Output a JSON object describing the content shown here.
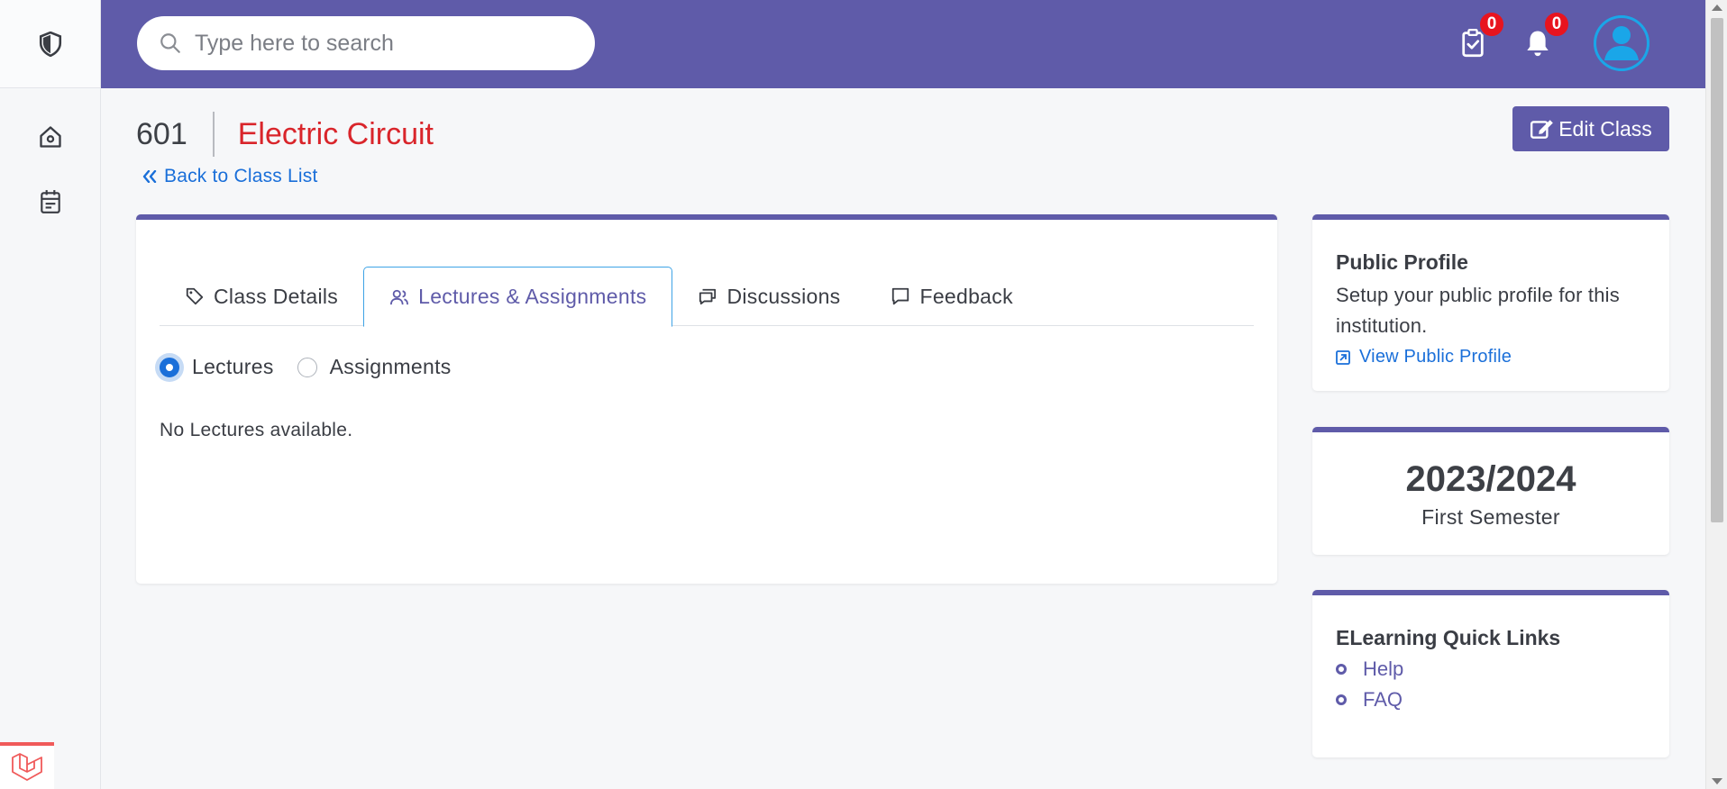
{
  "header": {
    "search_placeholder": "Type here to search",
    "tasks_badge": "0",
    "notifications_badge": "0"
  },
  "page": {
    "class_code": "601",
    "class_name": "Electric Circuit",
    "back_link": "Back to Class List",
    "edit_button": "Edit Class"
  },
  "tabs": [
    {
      "label": "Class Details",
      "icon": "tag-icon"
    },
    {
      "label": "Lectures & Assignments",
      "icon": "users-icon",
      "active": true
    },
    {
      "label": "Discussions",
      "icon": "chat-bubbles-icon"
    },
    {
      "label": "Feedback",
      "icon": "comment-icon"
    }
  ],
  "filter": {
    "options": [
      "Lectures",
      "Assignments"
    ],
    "selected": "Lectures"
  },
  "content": {
    "empty_message": "No Lectures available."
  },
  "public_profile": {
    "title": "Public Profile",
    "description": "Setup your public profile for this institution.",
    "link": "View Public Profile"
  },
  "session": {
    "year": "2023/2024",
    "term": "First Semester"
  },
  "quick_links": {
    "title": "ELearning Quick Links",
    "items": [
      "Help",
      "FAQ"
    ]
  },
  "colors": {
    "brand": "#5f5ba9",
    "link": "#1a6fd9",
    "title_red": "#d9252b",
    "badge_red": "#e8141e"
  }
}
